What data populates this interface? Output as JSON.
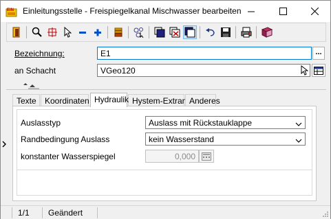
{
  "window": {
    "title": "Einleitungsstelle - Freispiegelkanal Mischwasser bearbeiten"
  },
  "toolbar": {
    "icons": [
      "exit-icon",
      "zoom-icon",
      "crosshair-icon",
      "pointer-icon",
      "minus-icon",
      "plus-icon",
      "layer-icon",
      "select-nodes-icon",
      "window-new-icon",
      "window-close-icon",
      "window-restore-icon",
      "undo-icon",
      "save-icon",
      "print-icon",
      "book-icon"
    ]
  },
  "header": {
    "bezeichnung_label": "Bezeichnung:",
    "bezeichnung_value": "E1",
    "bezeichnung_btn": "...",
    "schacht_label": "an Schacht",
    "schacht_value": "VGeo120"
  },
  "tabs": [
    {
      "label": "Texte"
    },
    {
      "label": "Koordinaten"
    },
    {
      "label": "Hydraulik"
    },
    {
      "label": "Hystem-Extran"
    },
    {
      "label": "Anderes"
    }
  ],
  "hydraulik": {
    "auslasstyp_label": "Auslasstyp",
    "auslasstyp_value": "Auslass mit Rückstauklappe",
    "randbedingung_label": "Randbedingung Auslass",
    "randbedingung_value": "kein Wasserstand",
    "wasserspiegel_label": "konstanter Wasserspiegel",
    "wasserspiegel_value": "0,000"
  },
  "statusbar": {
    "record": "1/1",
    "state": "Geändert"
  },
  "colors": {
    "accent": "#0078d7",
    "panel": "#f0f0f0"
  }
}
